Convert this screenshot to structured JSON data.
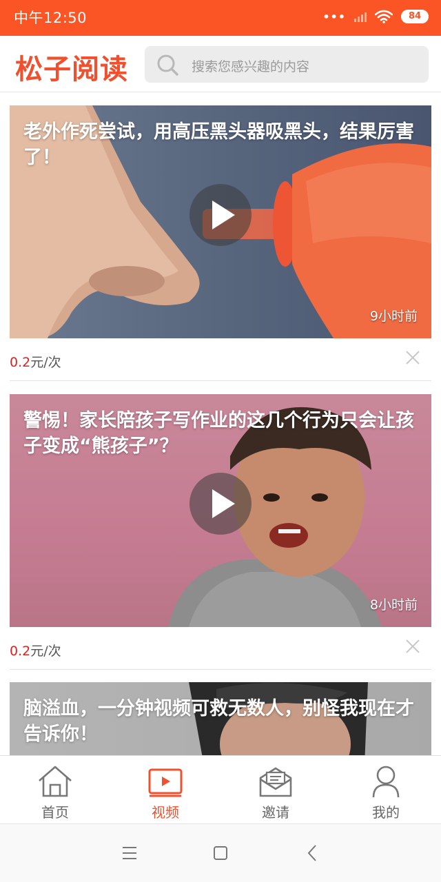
{
  "status_bar": {
    "time": "中午12:50",
    "dots": "•••",
    "battery": "84"
  },
  "header": {
    "app_title": "松子阅读",
    "search_placeholder": "搜索您感兴趣的内容"
  },
  "feed": [
    {
      "title": "老外作死尝试，用高压黑头器吸黑头，结果厉害了！",
      "time_ago": "9小时前",
      "reward_amount": "0.2",
      "reward_unit": "元/次"
    },
    {
      "title": "警惕！家长陪孩子写作业的这几个行为只会让孩子变成“熊孩子”？",
      "time_ago": "8小时前",
      "reward_amount": "0.2",
      "reward_unit": "元/次"
    },
    {
      "title": "脑溢血，一分钟视频可救无数人，别怪我现在才告诉你！",
      "time_ago": "",
      "reward_amount": "",
      "reward_unit": ""
    }
  ],
  "bottom_nav": [
    {
      "label": "首页",
      "icon": "home-icon",
      "active": false
    },
    {
      "label": "视频",
      "icon": "video-icon",
      "active": true
    },
    {
      "label": "邀请",
      "icon": "invite-mail-icon",
      "active": false
    },
    {
      "label": "我的",
      "icon": "profile-icon",
      "active": false
    }
  ],
  "colors": {
    "accent": "#f0502d",
    "status_bar": "#fb5425",
    "reward": "#e0201c"
  }
}
